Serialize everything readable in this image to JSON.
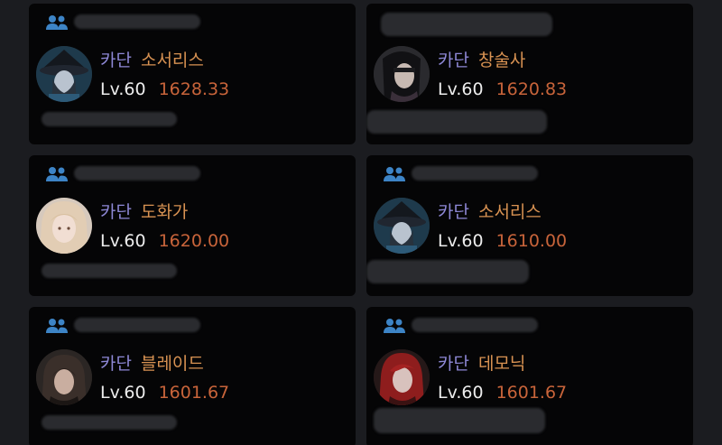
{
  "cards": [
    {
      "guild": "카단",
      "class": "소서리스",
      "level": "Lv.60",
      "item_level": "1628.33",
      "avatar_icon": "sorceress-portrait-icon"
    },
    {
      "guild": "카단",
      "class": "창술사",
      "level": "Lv.60",
      "item_level": "1620.83",
      "avatar_icon": "lancemaster-portrait-icon"
    },
    {
      "guild": "카단",
      "class": "도화가",
      "level": "Lv.60",
      "item_level": "1620.00",
      "avatar_icon": "artist-portrait-icon"
    },
    {
      "guild": "카단",
      "class": "소서리스",
      "level": "Lv.60",
      "item_level": "1610.00",
      "avatar_icon": "sorceress-portrait-icon"
    },
    {
      "guild": "카단",
      "class": "블레이드",
      "level": "Lv.60",
      "item_level": "1601.67",
      "avatar_icon": "blade-portrait-icon"
    },
    {
      "guild": "카단",
      "class": "데모닉",
      "level": "Lv.60",
      "item_level": "1601.67",
      "avatar_icon": "demonic-portrait-icon"
    }
  ],
  "colors": {
    "background": "#1b1c20",
    "card": "#050506",
    "guild_text": "#8e88d6",
    "class_text": "#d89252",
    "item_level_text": "#c8643a",
    "party_icon": "#3d84c6"
  }
}
